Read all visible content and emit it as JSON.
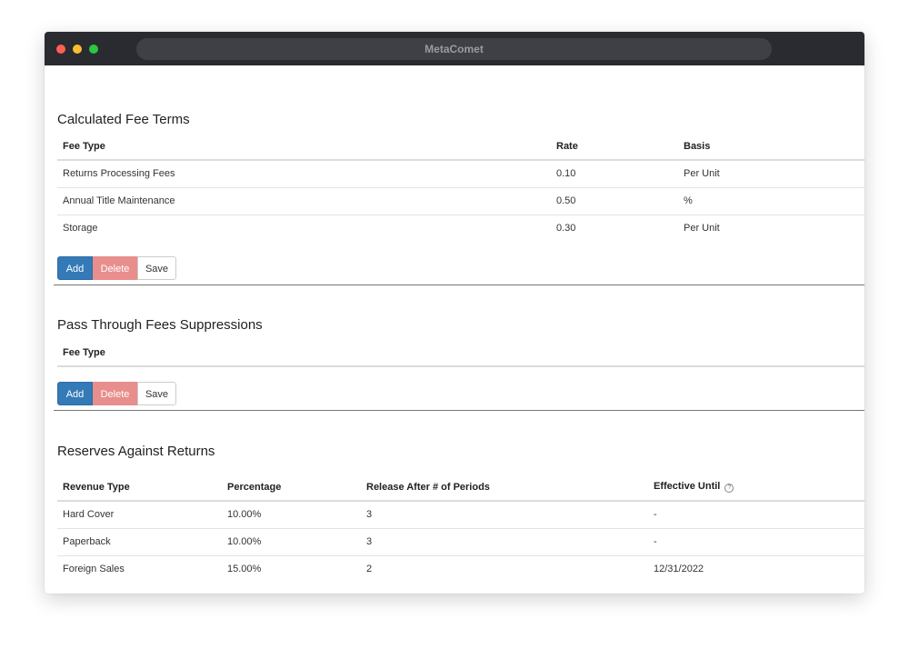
{
  "window": {
    "title": "MetaComet"
  },
  "calculated_fee_terms": {
    "title": "Calculated Fee Terms",
    "columns": [
      "Fee Type",
      "Rate",
      "Basis"
    ],
    "rows": [
      [
        "Returns Processing Fees",
        "0.10",
        "Per Unit"
      ],
      [
        "Annual Title Maintenance",
        "0.50",
        "%"
      ],
      [
        "Storage",
        "0.30",
        "Per Unit"
      ]
    ]
  },
  "pass_through": {
    "title": "Pass Through Fees Suppressions",
    "columns": [
      "Fee Type"
    ]
  },
  "reserves": {
    "title": "Reserves Against Returns",
    "columns": [
      "Revenue Type",
      "Percentage",
      "Release After # of Periods",
      "Effective Until"
    ],
    "help_glyph": "?",
    "rows": [
      [
        "Hard Cover",
        "10.00%",
        "3",
        "-"
      ],
      [
        "Paperback",
        "10.00%",
        "3",
        "-"
      ],
      [
        "Foreign Sales",
        "15.00%",
        "2",
        "12/31/2022"
      ]
    ]
  },
  "buttons": {
    "add": "Add",
    "delete": "Delete",
    "save": "Save"
  },
  "colors": {
    "add": "#337ab7",
    "delete": "#e88e8c",
    "titlebar": "#2a2b30"
  }
}
